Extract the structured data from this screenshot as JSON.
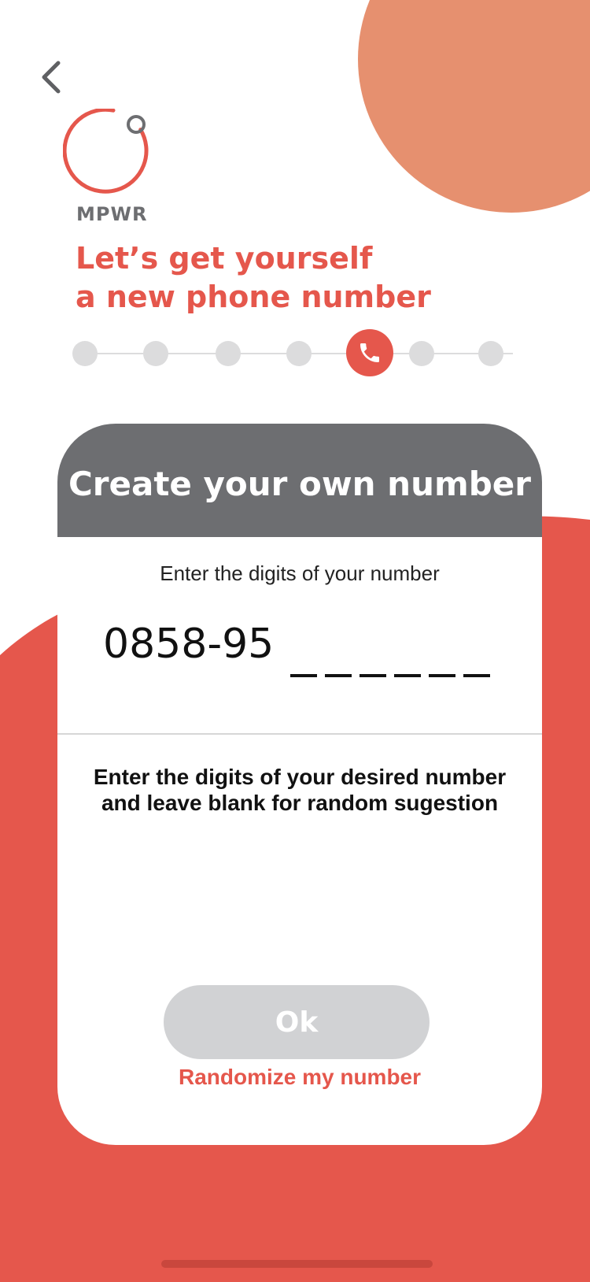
{
  "colors": {
    "accent": "#e5574c",
    "peach": "#e6906f",
    "header_gray": "#6d6e71",
    "step_inactive": "#dcdcdd",
    "button_disabled": "#d1d2d4"
  },
  "nav": {
    "back_icon": "chevron-left-icon"
  },
  "brand": {
    "logo_icon": "mpwr-ring-logo",
    "name": "MPWR"
  },
  "headline": {
    "line1": "Let’s get yourself",
    "line2": "a new phone number"
  },
  "stepper": {
    "total_steps": 7,
    "current_step": 5,
    "current_icon": "phone-icon"
  },
  "card": {
    "title": "Create your own number",
    "input_label": "Enter the digits of your number",
    "number_prefix": "0858-95",
    "blank_digits": 6,
    "hint_line1": "Enter the digits of your desired number",
    "hint_line2": "and leave blank for random sugestion",
    "ok_label": "Ok",
    "ok_enabled": false,
    "randomize_label": "Randomize my number"
  }
}
